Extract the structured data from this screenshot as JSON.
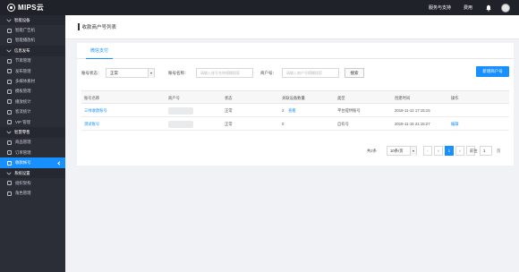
{
  "topbar": {
    "logo_text": "MIPS云",
    "service": "服务与支持",
    "docs": "费用"
  },
  "sidebar": {
    "items": [
      {
        "label": "智能设备",
        "type": "group"
      },
      {
        "label": "智能广告机",
        "type": "item"
      },
      {
        "label": "智能播放机",
        "type": "item"
      },
      {
        "label": "信息发布",
        "type": "group"
      },
      {
        "label": "节目管理",
        "type": "item"
      },
      {
        "label": "发布管理",
        "type": "item"
      },
      {
        "label": "多媒体素材",
        "type": "item"
      },
      {
        "label": "模板管理",
        "type": "item"
      },
      {
        "label": "播放统计",
        "type": "item"
      },
      {
        "label": "客流统计",
        "type": "item"
      },
      {
        "label": "VIP 管理",
        "type": "item"
      },
      {
        "label": "智慧零售",
        "type": "group"
      },
      {
        "label": "商品管理",
        "type": "item"
      },
      {
        "label": "订单管理",
        "type": "item"
      },
      {
        "label": "收款帐号",
        "type": "item",
        "active": true
      },
      {
        "label": "系统设置",
        "type": "group"
      },
      {
        "label": "组织架构",
        "type": "item"
      },
      {
        "label": "角色管理",
        "type": "item"
      }
    ]
  },
  "main": {
    "title": "收款商户号列表",
    "tab": "微信支付",
    "filters": {
      "status_label": "账号状态：",
      "status_value": "正常",
      "name_label": "账号名称：",
      "name_placeholder": "请输入账号名称模糊搜索",
      "merchant_label": "商户号：",
      "merchant_placeholder": "请输入商户号模糊搜索",
      "search_button": "搜索",
      "add_button": "新增商户号"
    },
    "table": {
      "headers": [
        "账号名称",
        "商户号",
        "状态",
        "关联设备数量",
        "类型",
        "创建时间",
        "操作"
      ],
      "rows": [
        {
          "name": "三帅收款账号",
          "merchant": "",
          "status": "正常",
          "devices": "2",
          "view": "查看",
          "type": "平台提供账号",
          "created": "2018-11-12 17:15:15",
          "action": ""
        },
        {
          "name": "测试账号",
          "merchant": "",
          "status": "正常",
          "devices": "0",
          "view": "",
          "type": "自有号",
          "created": "2018-11-15 21:15:27",
          "action": "编辑"
        }
      ]
    },
    "pagination": {
      "total_text": "共2条",
      "page_size": "10条/页",
      "current_page": "1",
      "goto_label": "前往",
      "goto_value": "1",
      "page_suffix": "页"
    }
  },
  "colors": {
    "accent": "#1890ff",
    "topbar": "#20222a",
    "sidebar": "#2b2e37"
  }
}
